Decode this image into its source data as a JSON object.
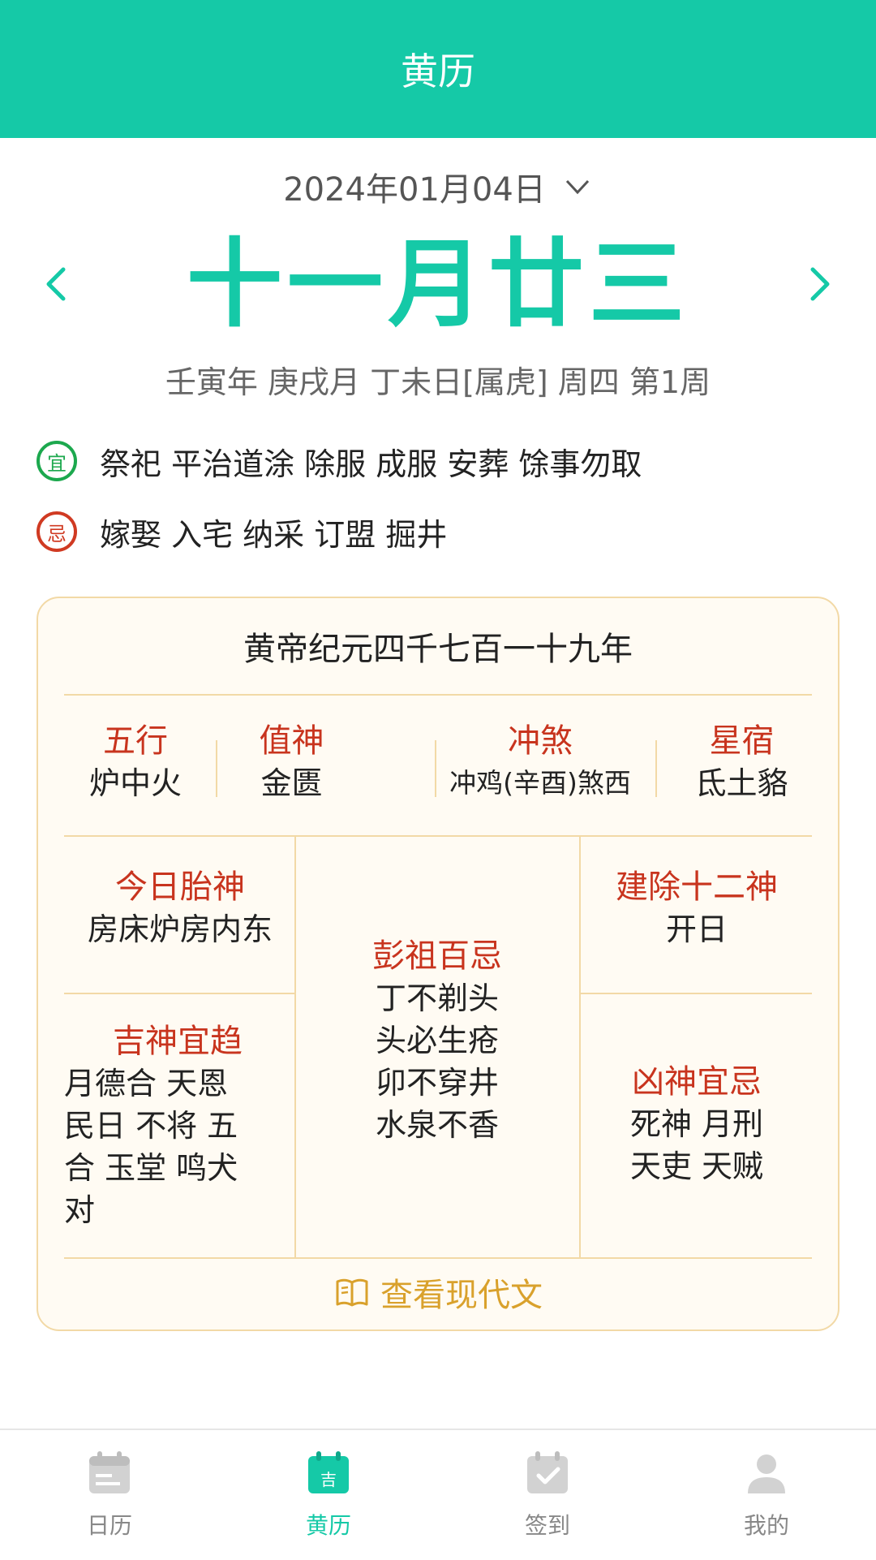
{
  "header": {
    "title": "黄历"
  },
  "date_selector": {
    "label": "2024年01月04日"
  },
  "lunar": {
    "date": "十一月廿三"
  },
  "ganzhi": "壬寅年 庚戌月 丁未日[属虎] 周四 第1周",
  "yi": {
    "badge": "宜",
    "items": "祭祀 平治道涂 除服 成服 安葬 馀事勿取",
    "color": "#1ca84e"
  },
  "ji": {
    "badge": "忌",
    "items": "嫁娶 入宅 纳采 订盟 掘井",
    "color": "#d03a22"
  },
  "card": {
    "title": "黄帝纪元四千七百一十九年",
    "wuxing": {
      "label": "五行",
      "value": "炉中火"
    },
    "zhishen": {
      "label": "值神",
      "value": "金匮"
    },
    "chongsha": {
      "label": "冲煞",
      "value": "冲鸡(辛酉)煞西"
    },
    "xingxiu": {
      "label": "星宿",
      "value": "氐土貉"
    },
    "taishen": {
      "label": "今日胎神",
      "value": "房床炉房内东"
    },
    "pengzu": {
      "label": "彭祖百忌",
      "lines": [
        "丁不剃头",
        "头必生疮",
        "卯不穿井",
        "水泉不香"
      ]
    },
    "jianchu": {
      "label": "建除十二神",
      "value": "开日"
    },
    "jishen": {
      "label": "吉神宜趋",
      "lines": [
        "月德合 天恩",
        "民日 不将 五",
        "合 玉堂 鸣犬",
        "对"
      ]
    },
    "xiongshen": {
      "label": "凶神宜忌",
      "lines": [
        "死神 月刑",
        "天吏 天贼"
      ]
    },
    "footer_label": "查看现代文"
  },
  "tabs": [
    {
      "label": "日历",
      "icon": "calendar-icon"
    },
    {
      "label": "黄历",
      "icon": "huangli-icon",
      "badge": "吉"
    },
    {
      "label": "签到",
      "icon": "checkin-icon"
    },
    {
      "label": "我的",
      "icon": "profile-icon"
    }
  ],
  "colors": {
    "accent": "#15c9a7",
    "red": "#c8341e",
    "gold": "#d9a12c",
    "card_bg": "#fffbf3"
  }
}
